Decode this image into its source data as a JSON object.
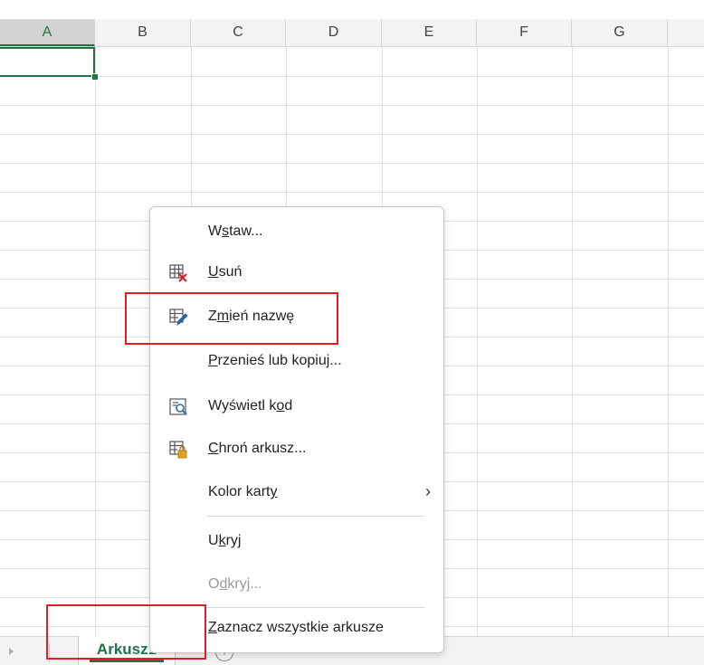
{
  "columns": [
    "A",
    "B",
    "C",
    "D",
    "E",
    "F",
    "G"
  ],
  "selected_column": "A",
  "sheet_tab": {
    "name": "Arkusz1"
  },
  "add_sheet_symbol": "+",
  "context_menu": {
    "items": [
      {
        "id": "insert",
        "pre": "W",
        "ul": "s",
        "post": "taw...",
        "icon": null
      },
      {
        "id": "delete",
        "pre": "",
        "ul": "U",
        "post": "suń",
        "icon": "delete-sheet-icon"
      },
      {
        "id": "rename",
        "pre": "Z",
        "ul": "m",
        "post": "ień nazwę",
        "icon": "rename-sheet-icon"
      },
      {
        "id": "move-copy",
        "pre": "",
        "ul": "P",
        "post": "rzenieś lub kopiuj...",
        "icon": null
      },
      {
        "id": "view-code",
        "pre": "Wyświetl k",
        "ul": "o",
        "post": "d",
        "icon": "view-code-icon"
      },
      {
        "id": "protect",
        "pre": "",
        "ul": "C",
        "post": "hroń arkusz...",
        "icon": "protect-sheet-icon"
      },
      {
        "id": "tab-color",
        "pre": "Kolor kart",
        "ul": "y",
        "post": "",
        "icon": null,
        "submenu": true
      },
      {
        "id": "hide",
        "pre": "U",
        "ul": "k",
        "post": "ryj",
        "icon": null
      },
      {
        "id": "unhide",
        "pre": "O",
        "ul": "d",
        "post": "kryj...",
        "icon": null,
        "disabled": true
      },
      {
        "id": "select-all",
        "pre": "",
        "ul": "Z",
        "post": "aznacz wszystkie arkusze",
        "icon": null
      }
    ],
    "submenu_arrow": "›"
  },
  "colors": {
    "accent": "#217346",
    "highlight": "#e02020"
  }
}
